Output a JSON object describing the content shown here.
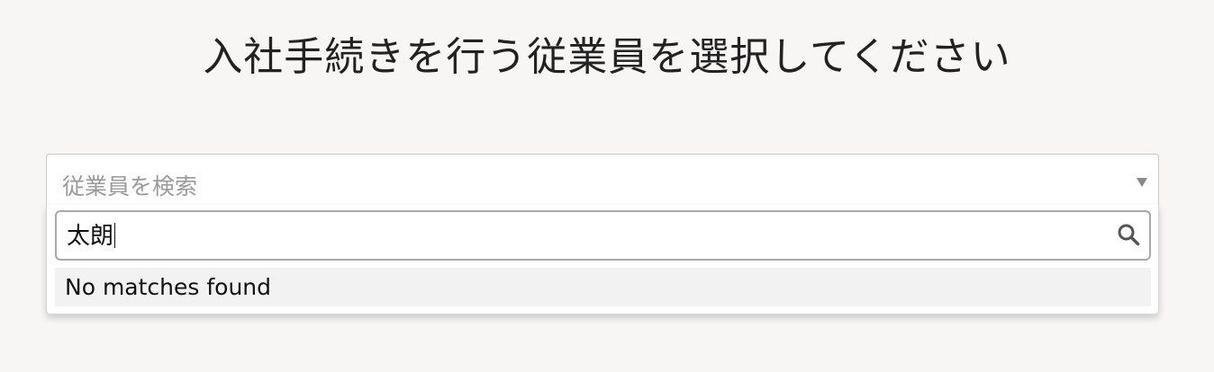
{
  "page": {
    "title": "入社手続きを行う従業員を選択してください"
  },
  "employee_select": {
    "placeholder": "従業員を検索",
    "arrow_icon": "caret-down-icon"
  },
  "dropdown": {
    "search_value": "太朗",
    "search_icon": "search-icon",
    "results_message": "No matches found"
  },
  "colors": {
    "background": "#f7f6f5",
    "text": "#222222",
    "placeholder": "#9a9a9a",
    "result_row_bg": "#f2f2f2"
  }
}
